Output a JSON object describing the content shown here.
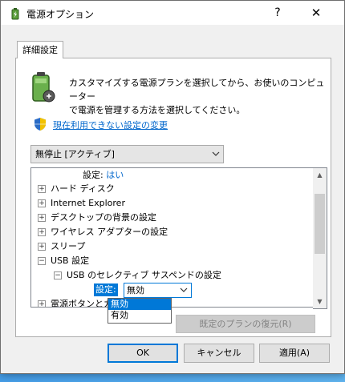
{
  "window": {
    "title": "電源オプション",
    "help_glyph": "?",
    "close_glyph": "✕"
  },
  "tab": {
    "label": "詳細設定"
  },
  "description": {
    "line1": "カスタマイズする電源プランを選択してから、お使いのコンピューター",
    "line2": "で電源を管理する方法を選択してください。"
  },
  "link": {
    "label": "現在利用できない設定の変更"
  },
  "plan_combo": {
    "value": "無停止 [アクティブ]"
  },
  "tree": {
    "setting_label": "設定:",
    "setting_value": "はい",
    "items": [
      {
        "label": "ハード ディスク",
        "expander": "+"
      },
      {
        "label": "Internet Explorer",
        "expander": "+"
      },
      {
        "label": "デスクトップの背景の設定",
        "expander": "+"
      },
      {
        "label": "ワイヤレス アダプターの設定",
        "expander": "+"
      },
      {
        "label": "スリープ",
        "expander": "+"
      },
      {
        "label": "USB 設定",
        "expander": "−"
      }
    ],
    "usb_sub": {
      "label": "USB のセレクティブ サスペンドの設定",
      "expander": "−"
    },
    "usb_setting_label": "設定:",
    "usb_setting_value": "無効",
    "next_item_partial": "電源ボタンとカバー"
  },
  "dropdown": {
    "options": [
      "無効",
      "有効"
    ]
  },
  "buttons": {
    "restore": "既定のプランの復元(R)",
    "ok": "OK",
    "cancel": "キャンセル",
    "apply": "適用(A)"
  },
  "colors": {
    "accent": "#0078d7",
    "link": "#0066cc"
  }
}
